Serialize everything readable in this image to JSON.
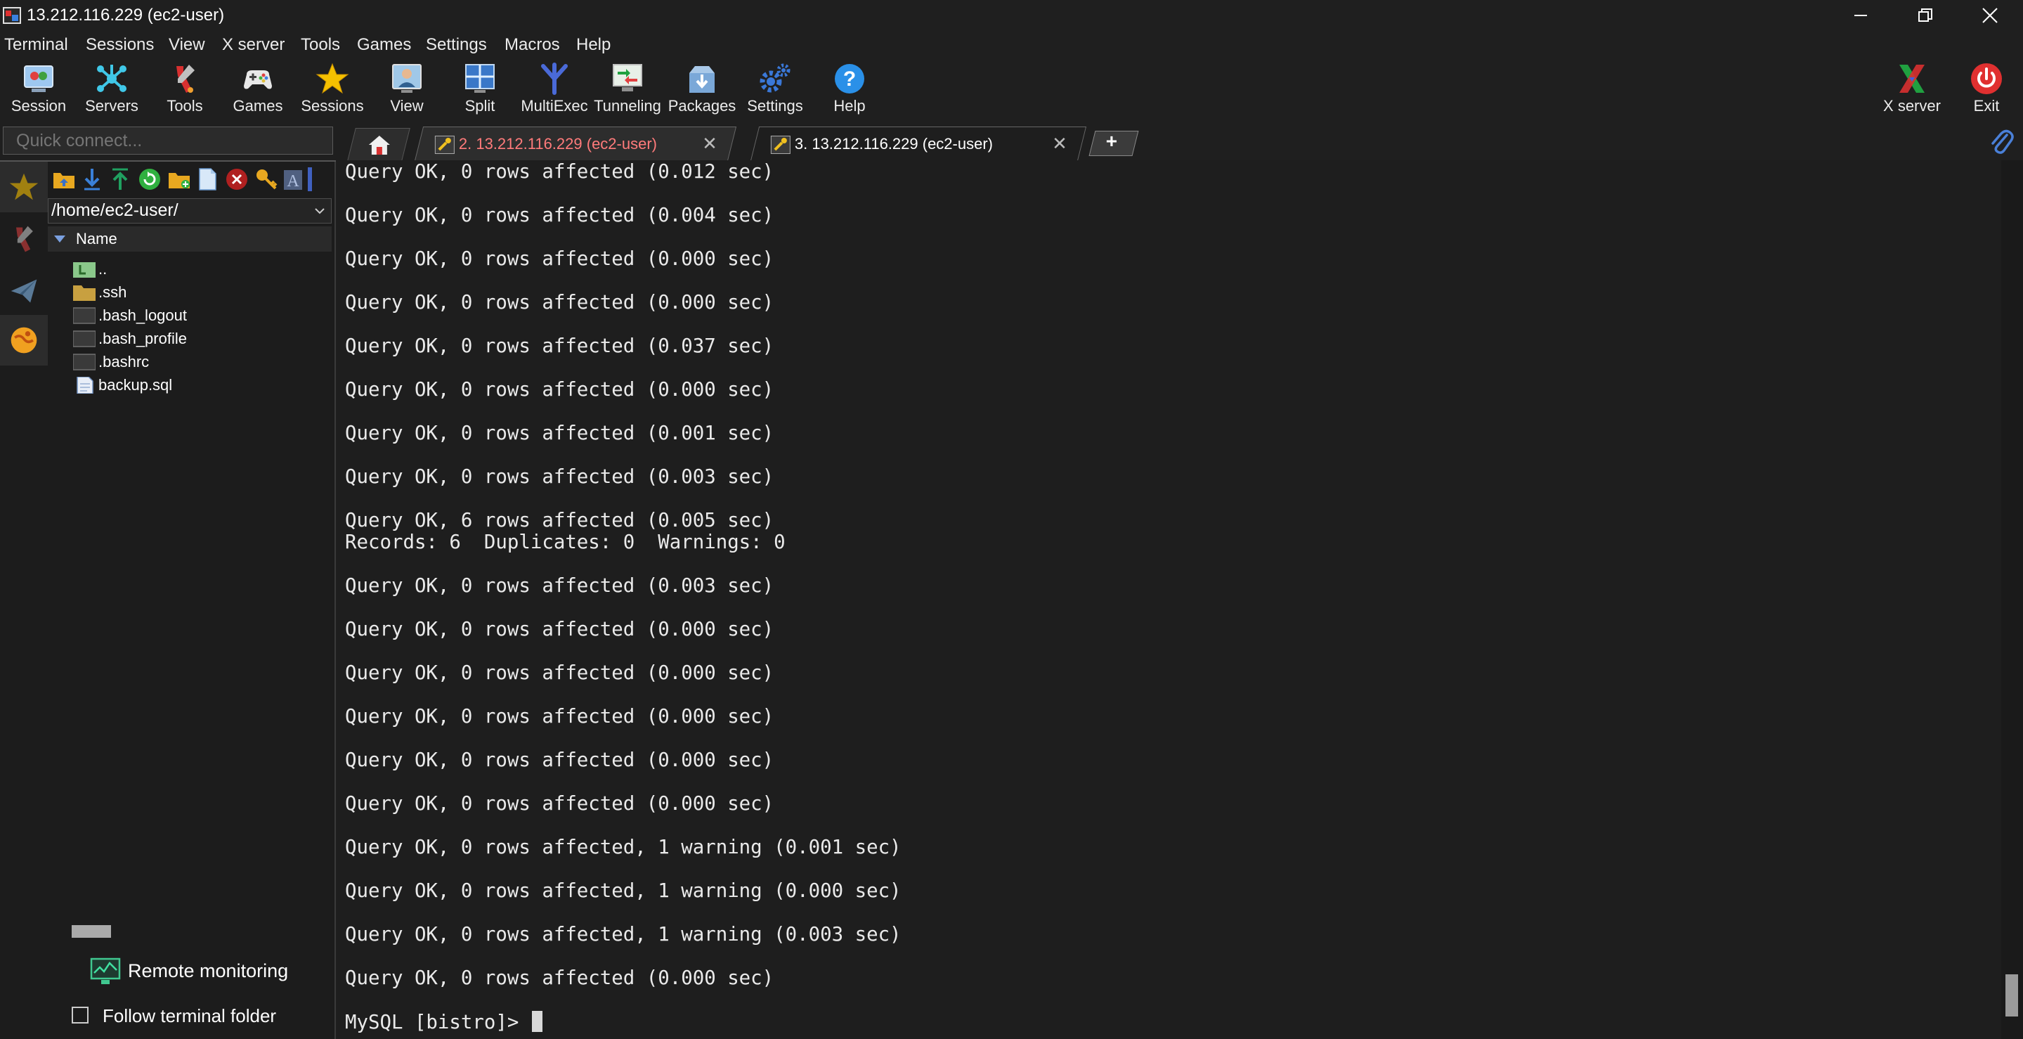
{
  "window": {
    "title": "13.212.116.229 (ec2-user)",
    "controls": [
      "minimize",
      "restore",
      "close"
    ]
  },
  "menu": [
    "Terminal",
    "Sessions",
    "View",
    "X server",
    "Tools",
    "Games",
    "Settings",
    "Macros",
    "Help"
  ],
  "toolbar": {
    "buttons": [
      "Session",
      "Servers",
      "Tools",
      "Games",
      "Sessions",
      "View",
      "Split",
      "MultiExec",
      "Tunneling",
      "Packages",
      "Settings",
      "Help"
    ],
    "right_buttons": [
      "X server",
      "Exit"
    ]
  },
  "quick_connect": {
    "placeholder": "Quick connect..."
  },
  "tabs": [
    {
      "label": "2. 13.212.116.229 (ec2-user)",
      "active": false,
      "color": "#ff7b7b"
    },
    {
      "label": "3. 13.212.116.229 (ec2-user)",
      "active": true,
      "color": "#ffffff"
    }
  ],
  "sftp": {
    "path": "/home/ec2-user/",
    "column_header": "Name",
    "files": [
      {
        "name": "..",
        "icon": "parent-folder-icon"
      },
      {
        "name": ".ssh",
        "icon": "folder-icon"
      },
      {
        "name": ".bash_logout",
        "icon": "file-icon"
      },
      {
        "name": ".bash_profile",
        "icon": "file-icon"
      },
      {
        "name": ".bashrc",
        "icon": "file-icon"
      },
      {
        "name": "backup.sql",
        "icon": "document-icon"
      }
    ],
    "remote_monitoring": "Remote monitoring",
    "follow_terminal_folder": "Follow terminal folder",
    "follow_checked": false
  },
  "terminal": {
    "lines": [
      "Query OK, 0 rows affected (0.012 sec)",
      "Query OK, 0 rows affected (0.004 sec)",
      "Query OK, 0 rows affected (0.000 sec)",
      "Query OK, 0 rows affected (0.000 sec)",
      "Query OK, 0 rows affected (0.037 sec)",
      "Query OK, 0 rows affected (0.000 sec)",
      "Query OK, 0 rows affected (0.001 sec)",
      "Query OK, 0 rows affected (0.003 sec)",
      "Query OK, 6 rows affected (0.005 sec)",
      "Records: 6  Duplicates: 0  Warnings: 0",
      "Query OK, 0 rows affected (0.003 sec)",
      "Query OK, 0 rows affected (0.000 sec)",
      "Query OK, 0 rows affected (0.000 sec)",
      "Query OK, 0 rows affected (0.000 sec)",
      "Query OK, 0 rows affected (0.000 sec)",
      "Query OK, 0 rows affected (0.000 sec)",
      "Query OK, 0 rows affected, 1 warning (0.001 sec)",
      "Query OK, 0 rows affected, 1 warning (0.000 sec)",
      "Query OK, 0 rows affected, 1 warning (0.003 sec)",
      "Query OK, 0 rows affected (0.000 sec)"
    ],
    "prompt": "MySQL [bistro]> "
  }
}
